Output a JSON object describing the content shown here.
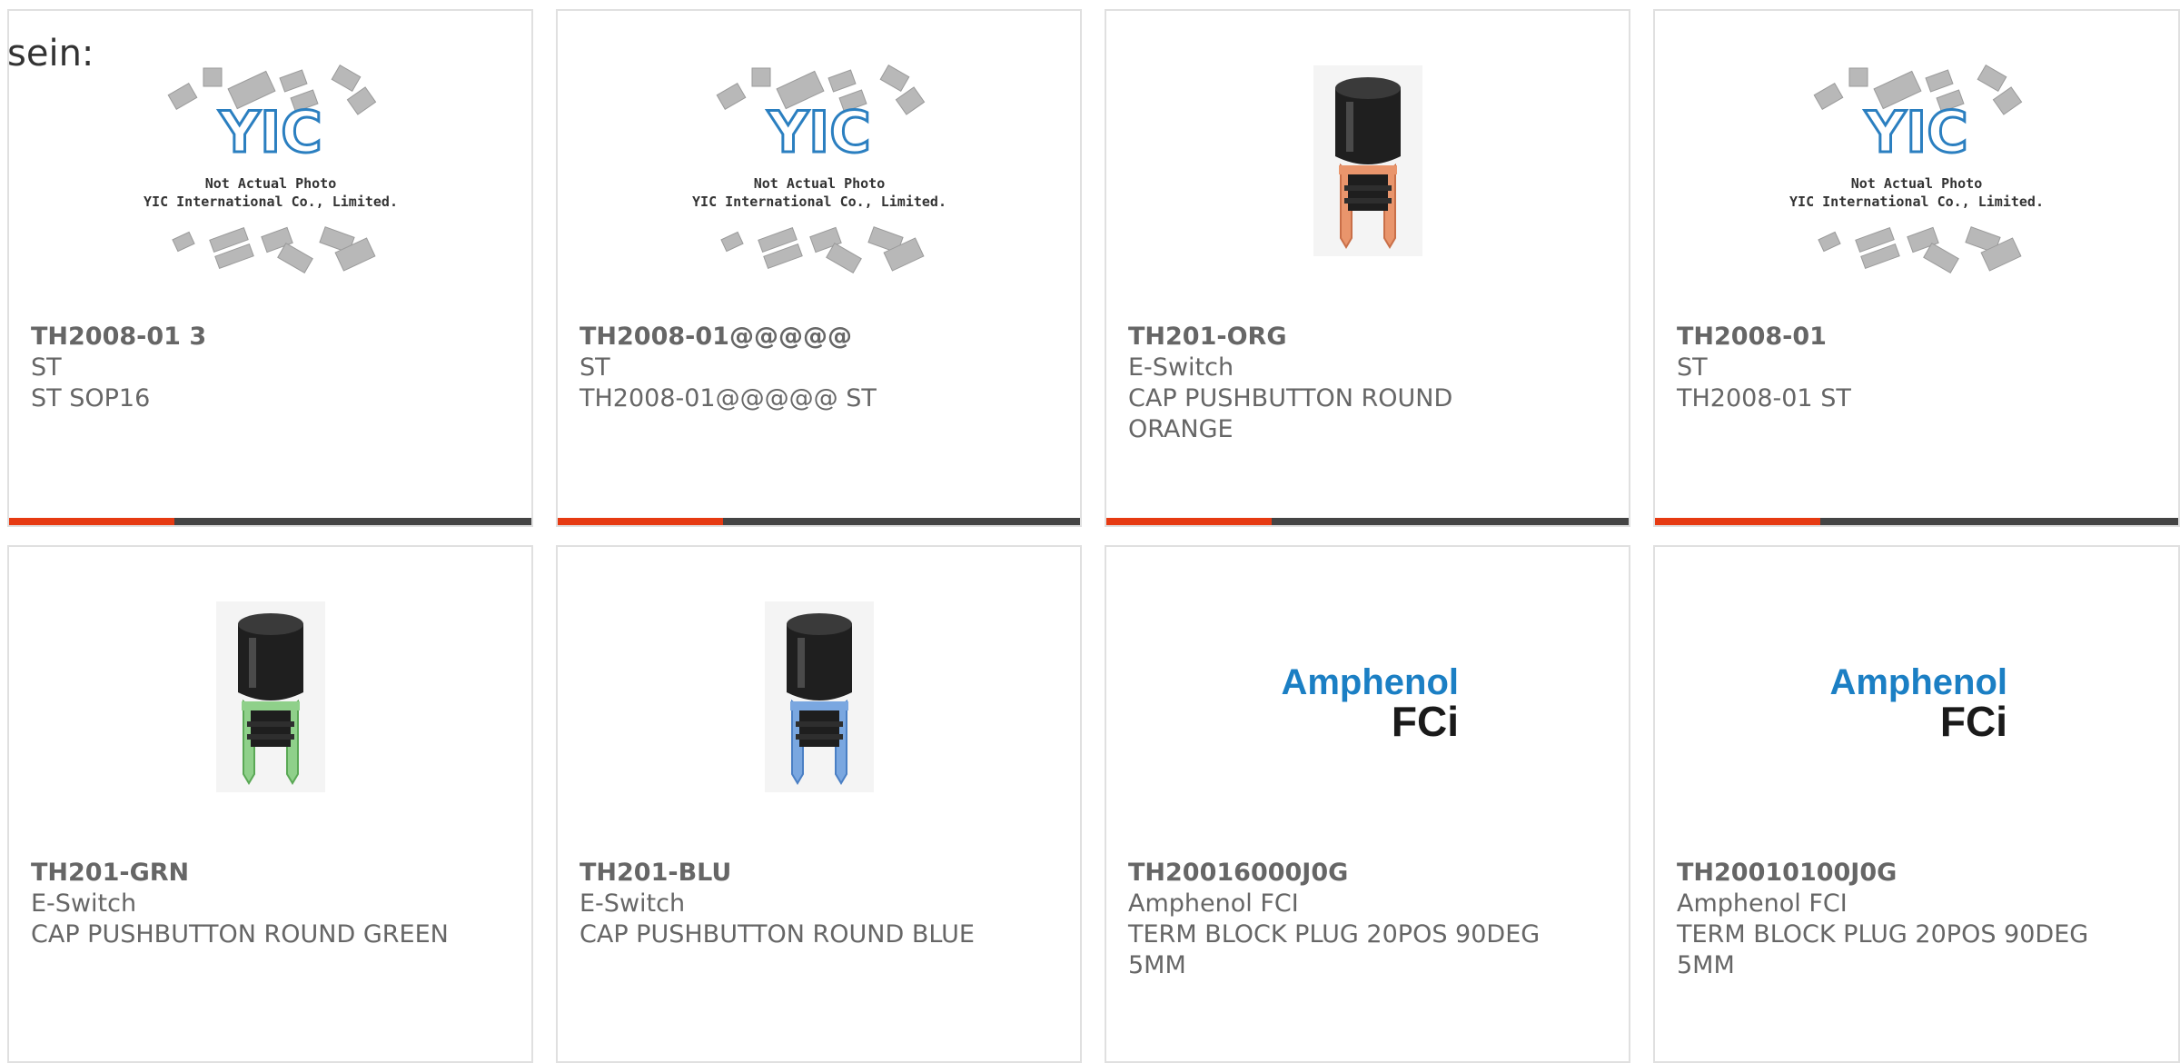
{
  "stray_text": "sein:",
  "colors": {
    "accent": "#e63a12",
    "bar": "#444444",
    "text": "#666666",
    "border": "#e0e0e0"
  },
  "placeholder": {
    "logo": "YIC",
    "line1": "Not Actual Photo",
    "line2": "YIC International Co., Limited."
  },
  "brand_logo": {
    "top": "Amphenol",
    "bottom": "FCi"
  },
  "products": [
    {
      "part": "TH2008-01 3",
      "mfr": "ST",
      "desc": "ST SOP16",
      "image": "placeholder"
    },
    {
      "part": "TH2008-01@@@@@",
      "mfr": "ST",
      "desc": "TH2008-01@@@@@ ST",
      "image": "placeholder"
    },
    {
      "part": "TH201-ORG",
      "mfr": "E-Switch",
      "desc": "CAP PUSHBUTTON ROUND ORANGE",
      "image": "cap-orange"
    },
    {
      "part": "TH2008-01",
      "mfr": "ST",
      "desc": "TH2008-01 ST",
      "image": "placeholder"
    },
    {
      "part": "TH201-GRN",
      "mfr": "E-Switch",
      "desc": "CAP PUSHBUTTON ROUND GREEN",
      "image": "cap-green"
    },
    {
      "part": "TH201-BLU",
      "mfr": "E-Switch",
      "desc": "CAP PUSHBUTTON ROUND BLUE",
      "image": "cap-blue"
    },
    {
      "part": "TH20016000J0G",
      "mfr": "Amphenol FCI",
      "desc": "TERM BLOCK PLUG 20POS 90DEG 5MM",
      "image": "amphenol"
    },
    {
      "part": "TH20010100J0G",
      "mfr": "Amphenol FCI",
      "desc": "TERM BLOCK PLUG 20POS 90DEG 5MM",
      "image": "amphenol"
    }
  ]
}
